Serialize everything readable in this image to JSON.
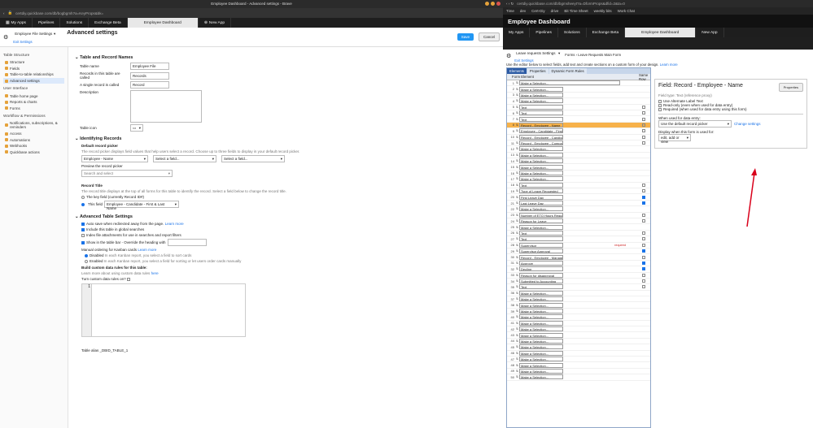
{
  "left": {
    "window_title": "Employee Dashboard - Advanced settings - Brave",
    "url": "certdiy.quickbase.com/db/bogbgmh?a=KeyProps&bk=",
    "apps": [
      "My Apps",
      "Pipelines",
      "Solutions",
      "Exchange Beta",
      "Employee Dashboard",
      "New App"
    ],
    "table_selector": "Employee File Settings",
    "exit": "Exit Settings",
    "page_title": "Advanced settings",
    "save": "Save",
    "cancel": "Cancel",
    "sidebar": {
      "g1": "Table Structure",
      "g1items": [
        "Structure",
        "Fields",
        "Table-to-table relationships",
        "Advanced settings"
      ],
      "g2": "User Interface",
      "g2items": [
        "Table home page",
        "Reports & charts",
        "Forms"
      ],
      "g3": "Workflow & Permissions",
      "g3items": [
        "Notifications, subscriptions, & reminders",
        "Access",
        "Automations",
        "Webhooks",
        "Quickbase actions"
      ]
    },
    "names": {
      "title": "Table and Record Names",
      "l1": "Table name",
      "v1": "Employee File",
      "l2": "Records in this table are called",
      "v2": "Records",
      "l3": "A single record is called",
      "v3": "Record",
      "l4": "Description",
      "l5": "Table icon"
    },
    "ident": {
      "title": "Identifying Records",
      "picker": "Default record picker",
      "picker_desc": "The record picker displays field values that help users select a record. Choose up to three fields to display in your default record picker.",
      "f1": "Employee - Name",
      "f2": "Select a field...",
      "f3": "Select a field...",
      "preview": "Preview the record picker",
      "search": "Search and select",
      "rt": "Record Title",
      "rt_desc": "The record title displays at the top of all forms for this table to identify the record. Select a field below to change the record title.",
      "o1": "The key field (currently Record ID#)",
      "o2": "This field",
      "o2v": "Employee - Candidate - First & Last Name"
    },
    "adv": {
      "title": "Advanced Table Settings",
      "c1": "Auto save when redirected away from the page.",
      "c1l": "Learn more",
      "c2": "Include this table in global searches",
      "c3": "Index file attachments for use in searches and report filters",
      "c4": "Show in the table bar - Override the heading with",
      "kanban": "Manual ordering for Kanban cards",
      "kanban_l": "Learn more",
      "k1": "Disabled",
      "k1d": "In each Kanban report, you select a field to sort cards",
      "k2": "Enabled",
      "k2d": "In each Kanban report, you select a field for sorting or let users order cards manually",
      "cdr": "Build custom data rules for this table:",
      "cdr_l": "Learn more about using custom data rules",
      "cdr_here": "here",
      "cdr_q": "Turn custom data rules on?",
      "line1": "1",
      "alias": "Table alias _DBID_TABLE_1"
    }
  },
  "right": {
    "url": "certdiy.quickbase.com/db/bgmsheeyt?a=DformProps&dfid=2&ta=0",
    "bookmarks": [
      "Time",
      "dev",
      "Cert-Diy",
      "drive",
      "Bit Time Sheet",
      "weekly bits",
      "Work Chat"
    ],
    "header": "Employee Dashboard",
    "apps": [
      "My Apps",
      "Pipelines",
      "Solutions",
      "Exchange Beta",
      "Employee Dashboard",
      "New App"
    ],
    "form_selector": "Leave requests Settings",
    "exit": "Exit Settings",
    "crumb": "Forms › Leave Requests Main Form",
    "hint": "Use the editor below to select fields, add text and create sections on a custom form of your design.",
    "hint_l": "Learn more",
    "tabs": [
      "Elements",
      "Properties",
      "Dynamic Form Rules"
    ],
    "col1": "Form Element",
    "col2": "Same Row",
    "rows": [
      {
        "n": "1",
        "t": "Make a Selection...",
        "w": "wide"
      },
      {
        "n": "2",
        "t": "Make a Selection..."
      },
      {
        "n": "3",
        "t": "Make a Selection..."
      },
      {
        "n": "4",
        "t": "Make a Selection..."
      },
      {
        "n": "5",
        "t": "Text",
        "b": "0"
      },
      {
        "n": "6",
        "t": "Text",
        "b": "0"
      },
      {
        "n": "7",
        "t": "Text",
        "b": "0"
      },
      {
        "n": "8",
        "t": "Record - Employee - Name",
        "hl": "1",
        "b": "0"
      },
      {
        "n": "9",
        "t": "Employee - Candidate - First & Last Name",
        "b": "0"
      },
      {
        "n": "10",
        "t": "Record - Employee - Candidate - Positions - Title",
        "b": "0"
      },
      {
        "n": "11",
        "t": "Record - Employee - Company E-Mail",
        "b": "0"
      },
      {
        "n": "12",
        "t": "Make a Selection..."
      },
      {
        "n": "13",
        "t": "Make a Selection..."
      },
      {
        "n": "14",
        "t": "Make a Selection..."
      },
      {
        "n": "15",
        "t": "Make a Selection..."
      },
      {
        "n": "16",
        "t": "Make a Selection..."
      },
      {
        "n": "17",
        "t": "Make a Selection..."
      },
      {
        "n": "18",
        "t": "Text",
        "b": "0"
      },
      {
        "n": "19",
        "t": "Type of Leave Requested",
        "b": "0"
      },
      {
        "n": "20",
        "t": "First Leave Day",
        "b": "1"
      },
      {
        "n": "21",
        "t": "Last Leave Day",
        "b": "1"
      },
      {
        "n": "22",
        "t": "Make a Selection..."
      },
      {
        "n": "23",
        "t": "Number of ETO Hours Requesting to Use",
        "b": "0"
      },
      {
        "n": "24",
        "t": "Reason for Leave",
        "b": "0"
      },
      {
        "n": "25",
        "t": "Make a Selection..."
      },
      {
        "n": "26",
        "t": "Text",
        "b": "0"
      },
      {
        "n": "27",
        "t": "Text",
        "b": "0"
      },
      {
        "n": "28",
        "t": "Supervisor",
        "req": "required",
        "b": "0"
      },
      {
        "n": "29",
        "t": "Supervisor Approval",
        "b": "1"
      },
      {
        "n": "30",
        "t": "Record - Employee - Managers Email",
        "b": "0"
      },
      {
        "n": "31",
        "t": "Approve",
        "b": "1"
      },
      {
        "n": "32",
        "t": "Decline",
        "b": "1"
      },
      {
        "n": "33",
        "t": "Reason for disapproval",
        "b": "0"
      },
      {
        "n": "34",
        "t": "Submitted to Accounting",
        "b": "0"
      },
      {
        "n": "35",
        "t": "Text",
        "b": "0"
      },
      {
        "n": "36",
        "t": "Make a Selection..."
      },
      {
        "n": "37",
        "t": "Make a Selection..."
      },
      {
        "n": "38",
        "t": "Make a Selection..."
      },
      {
        "n": "39",
        "t": "Make a Selection..."
      },
      {
        "n": "40",
        "t": "Make a Selection..."
      },
      {
        "n": "41",
        "t": "Make a Selection..."
      },
      {
        "n": "42",
        "t": "Make a Selection..."
      },
      {
        "n": "43",
        "t": "Make a Selection..."
      },
      {
        "n": "44",
        "t": "Make a Selection..."
      },
      {
        "n": "45",
        "t": "Make a Selection..."
      },
      {
        "n": "46",
        "t": "Make a Selection..."
      },
      {
        "n": "47",
        "t": "Make a Selection..."
      },
      {
        "n": "48",
        "t": "Make a Selection..."
      },
      {
        "n": "49",
        "t": "Make a Selection..."
      },
      {
        "n": "50",
        "t": "Make a Selection..."
      }
    ],
    "panel": {
      "title": "Field: Record - Employee - Name",
      "props": "Properties",
      "type": "Field type: Text (reference proxy)",
      "c1": "Use Alternate Label Text",
      "c2": "Read-only (even when used for data entry)",
      "c3": "Required (when used for data entry using this form)",
      "dl": "When used for data entry:",
      "dv": "Use the default record picker",
      "change": "Change settings",
      "vl": "Display when this form is used for:",
      "vv": "edit, add or view"
    }
  },
  "colors": {
    "accent": "#2196f3",
    "highlight": "#f7b24a",
    "arrow": "#d9001b"
  }
}
